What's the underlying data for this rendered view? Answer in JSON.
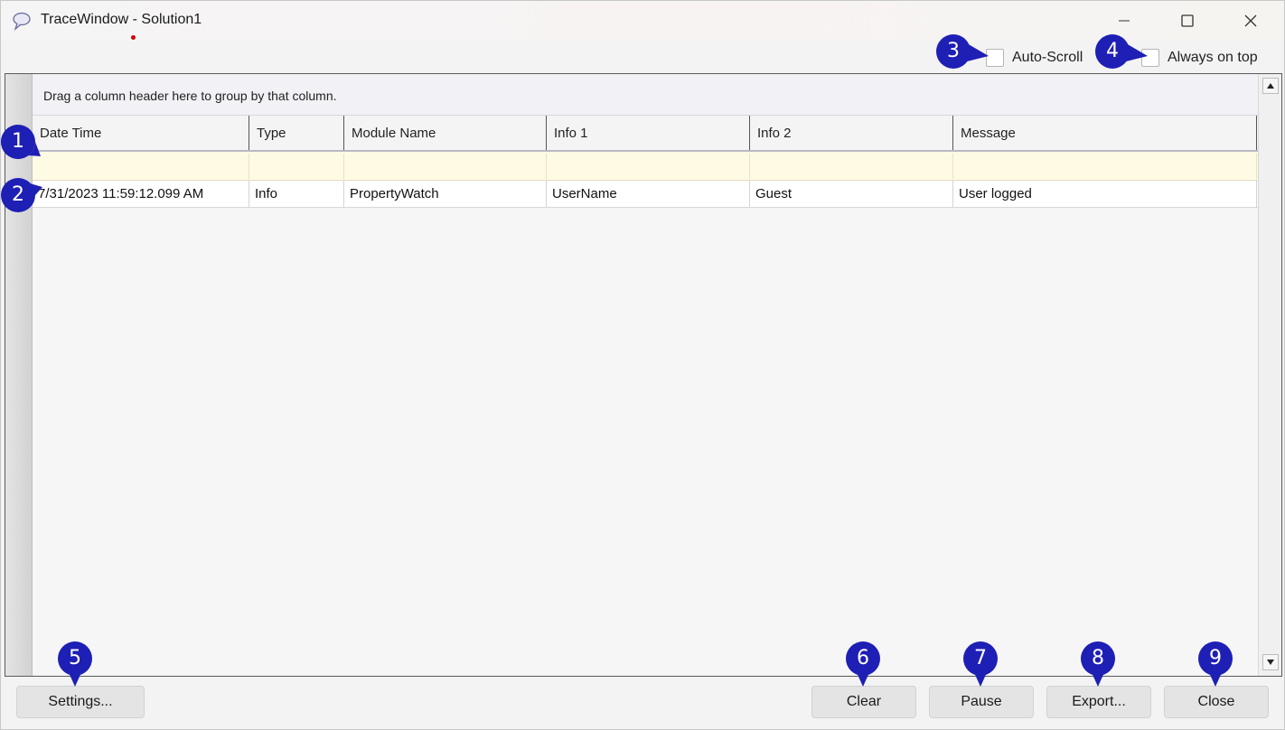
{
  "window": {
    "title": "TraceWindow - Solution1",
    "icon": "speech-bubble-icon",
    "controls": {
      "minimize": "minimize-icon",
      "maximize": "maximize-icon",
      "close": "close-icon"
    }
  },
  "options": {
    "auto_scroll_label": "Auto-Scroll",
    "auto_scroll_checked": false,
    "always_on_top_label": "Always on top",
    "always_on_top_checked": false
  },
  "grid": {
    "group_hint": "Drag a column header here to group by that column.",
    "columns": [
      "Date Time",
      "Type",
      "Module Name",
      "Info 1",
      "Info 2",
      "Message"
    ],
    "rows": [
      [
        "7/31/2023 11:59:12.099 AM",
        "Info",
        "PropertyWatch",
        "UserName",
        "Guest",
        "User logged"
      ]
    ]
  },
  "buttons": {
    "settings": "Settings...",
    "clear": "Clear",
    "pause": "Pause",
    "export": "Export...",
    "close": "Close"
  },
  "markers": [
    "1",
    "2",
    "3",
    "4",
    "5",
    "6",
    "7",
    "8",
    "9"
  ],
  "colors": {
    "marker": "#1e1fb4",
    "filter_row": "#fefae4",
    "title_dot": "#d00000"
  }
}
